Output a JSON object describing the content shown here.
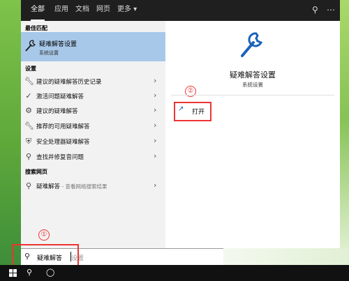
{
  "tabs": [
    "全部",
    "应用",
    "文档",
    "网页",
    "更多 ▾"
  ],
  "best_match": {
    "header": "最佳匹配",
    "title": "疑难解答设置",
    "subtitle": "系统设置"
  },
  "settings": {
    "header": "设置",
    "items": [
      {
        "label": "建议的疑难解答历史记录",
        "icon": "wrench-icon"
      },
      {
        "label": "激活问题疑难解答",
        "icon": "check-circle-icon"
      },
      {
        "label": "建议的疑难解答",
        "icon": "person-wrench-icon"
      },
      {
        "label": "推荐的可用疑难解答",
        "icon": "wrench-icon"
      },
      {
        "label": "安全处理器疑难解答",
        "icon": "shield-icon"
      },
      {
        "label": "查找并修复音问题",
        "icon": "search-icon"
      }
    ]
  },
  "web": {
    "header": "搜索网页",
    "item_label": "疑难解答",
    "item_suffix": " - 查看网络搜索结果"
  },
  "detail": {
    "title": "疑难解答设置",
    "subtitle": "系统设置",
    "open_label": "打开"
  },
  "search": {
    "value": "疑难解答",
    "hint": "设置"
  },
  "annotations": [
    "①",
    "②"
  ],
  "colors": {
    "accent": "#1a63b8",
    "selected_bg": "#a7c8e8",
    "annotation": "#e33333"
  }
}
